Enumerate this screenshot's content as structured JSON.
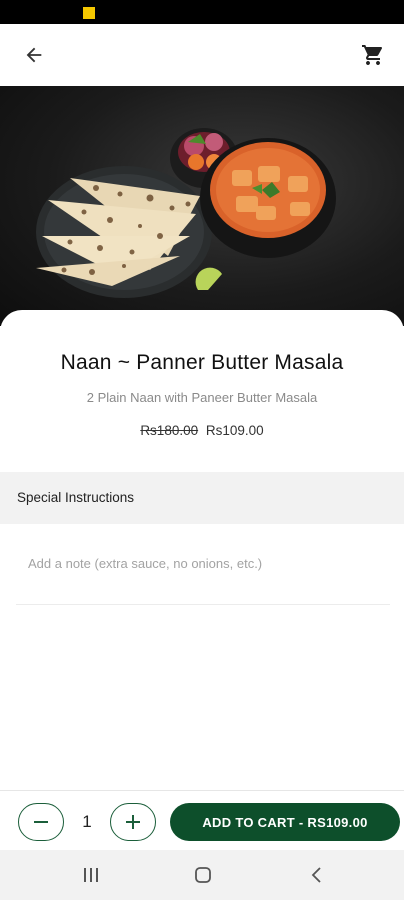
{
  "app_bar": {
    "back_icon": "arrow-left-icon",
    "cart_icon": "shopping-cart-icon"
  },
  "hero": {
    "image": "naan-and-paneer-butter-masala-photo"
  },
  "product": {
    "title": "Naan ~ Panner Butter Masala",
    "description": "2 Plain Naan with Paneer Butter Masala",
    "price_old": "Rs180.00",
    "price_new": "Rs109.00"
  },
  "special_instructions": {
    "label": "Special Instructions",
    "placeholder": "Add a note (extra sauce, no onions, etc.)",
    "value": ""
  },
  "cart_controls": {
    "quantity": "1",
    "minus_icon": "minus-icon",
    "plus_icon": "plus-icon",
    "add_button_label": "ADD TO CART - RS109.00"
  },
  "colors": {
    "accent": "#0d4f2b",
    "status_indicator": "#f5c800"
  },
  "system_nav": {
    "recent_icon": "recent-apps-icon",
    "home_icon": "home-icon",
    "back_icon": "back-chevron-icon"
  }
}
